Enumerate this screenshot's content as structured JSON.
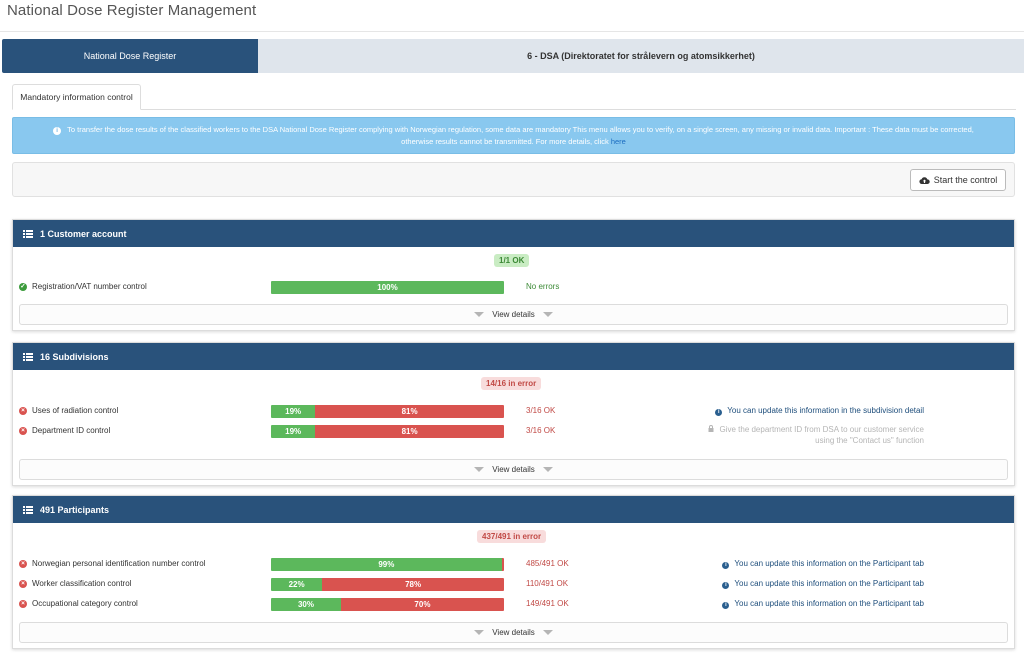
{
  "page_title": "National Dose Register Management",
  "top_tabs": [
    {
      "label": "National Dose Register"
    },
    {
      "label": "6 - DSA (Direktoratet for strålevern og atomsikkerhet)"
    }
  ],
  "sub_tab": "Mandatory information control",
  "info": {
    "text": "To transfer the dose results of the classified workers to the DSA National Dose Register complying with Norwegian regulation, some data are mandatory This menu allows you to verify, on a single screen, any missing or invalid data. Important : These data must be corrected, otherwise results cannot be transmitted. For more details, click ",
    "link": "here"
  },
  "start_button": "Start the control",
  "details_label": "View details",
  "colors": {
    "header": "#29527b",
    "ok": "#5cb85c",
    "error": "#d9534f",
    "info": "#89c8ef"
  },
  "sections": [
    {
      "title": "1 Customer account",
      "summary": "1/1 OK",
      "rows": [
        {
          "label": "Registration/VAT number control",
          "ok_pct": 100,
          "ok_text": "100%",
          "err_text": "",
          "status": "No errors"
        }
      ]
    },
    {
      "title": "16 Subdivisions",
      "summary": "14/16 in error",
      "rows": [
        {
          "label": "Uses of radiation control",
          "ok_pct": 19,
          "ok_text": "19%",
          "err_text": "81%",
          "status": "3/16 OK",
          "note": "You can update this information in the subdivision detail"
        },
        {
          "label": "Department ID control",
          "ok_pct": 19,
          "ok_text": "19%",
          "err_text": "81%",
          "status": "3/16 OK",
          "note_line1": "Give the department ID from DSA to our customer service",
          "note_line2": "using the \"Contact us\" function"
        }
      ]
    },
    {
      "title": "491 Participants",
      "summary": "437/491 in error",
      "rows": [
        {
          "label": "Norwegian personal identification number control",
          "ok_pct": 99,
          "ok_text": "99%",
          "err_text": "",
          "status": "485/491 OK",
          "note": "You can update this information on the Participant tab"
        },
        {
          "label": "Worker classification control",
          "ok_pct": 22,
          "ok_text": "22%",
          "err_text": "78%",
          "status": "110/491 OK",
          "note": "You can update this information on the Participant tab"
        },
        {
          "label": "Occupational category control",
          "ok_pct": 30,
          "ok_text": "30%",
          "err_text": "70%",
          "status": "149/491 OK",
          "note": "You can update this information on the Participant tab"
        }
      ]
    }
  ]
}
